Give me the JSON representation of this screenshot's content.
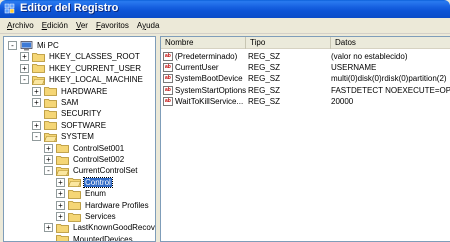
{
  "window": {
    "title": "Editor del Registro"
  },
  "menu": [
    {
      "first": "A",
      "rest": "rchivo"
    },
    {
      "first": "E",
      "rest": "dición"
    },
    {
      "first": "V",
      "rest": "er"
    },
    {
      "first": "F",
      "rest": "avoritos"
    },
    {
      "first": "Ay",
      "rest": "uda",
      "underline_index": 1
    }
  ],
  "tree": [
    {
      "label": "Mi PC",
      "expander": "-",
      "icon": "computer-icon",
      "level": 0
    },
    {
      "label": "HKEY_CLASSES_ROOT",
      "expander": "+",
      "level": 1
    },
    {
      "label": "HKEY_CURRENT_USER",
      "expander": "+",
      "level": 1
    },
    {
      "label": "HKEY_LOCAL_MACHINE",
      "expander": "-",
      "level": 1
    },
    {
      "label": "HARDWARE",
      "expander": "+",
      "level": 2
    },
    {
      "label": "SAM",
      "expander": "+",
      "level": 2
    },
    {
      "label": "SECURITY",
      "expander": "",
      "level": 2
    },
    {
      "label": "SOFTWARE",
      "expander": "+",
      "level": 2
    },
    {
      "label": "SYSTEM",
      "expander": "-",
      "level": 2
    },
    {
      "label": "ControlSet001",
      "expander": "+",
      "level": 3
    },
    {
      "label": "ControlSet002",
      "expander": "+",
      "level": 3
    },
    {
      "label": "CurrentControlSet",
      "expander": "-",
      "level": 3
    },
    {
      "label": "Control",
      "expander": "+",
      "level": 4,
      "selected": true
    },
    {
      "label": "Enum",
      "expander": "+",
      "level": 4
    },
    {
      "label": "Hardware Profiles",
      "expander": "+",
      "level": 4
    },
    {
      "label": "Services",
      "expander": "+",
      "level": 4
    },
    {
      "label": "LastKnownGoodRecove",
      "expander": "+",
      "level": 3
    },
    {
      "label": "MountedDevices",
      "expander": "",
      "level": 3
    }
  ],
  "list": {
    "columns": [
      "Nombre",
      "Tipo",
      "Datos"
    ],
    "rows": [
      {
        "name": "(Predeterminado)",
        "type": "REG_SZ",
        "data": "(valor no establecido)"
      },
      {
        "name": "CurrentUser",
        "type": "REG_SZ",
        "data": "USERNAME"
      },
      {
        "name": "SystemBootDevice",
        "type": "REG_SZ",
        "data": "multi(0)disk(0)rdisk(0)partition(2)"
      },
      {
        "name": "SystemStartOptions",
        "type": "REG_SZ",
        "data": "FASTDETECT NOEXECUTE=OPTIN"
      },
      {
        "name": "WaitToKillService...",
        "type": "REG_SZ",
        "data": "20000"
      }
    ]
  },
  "colors": {
    "titlebar": "#0a54d6",
    "selection": "#316ac5",
    "folder": "#f2d36b"
  }
}
